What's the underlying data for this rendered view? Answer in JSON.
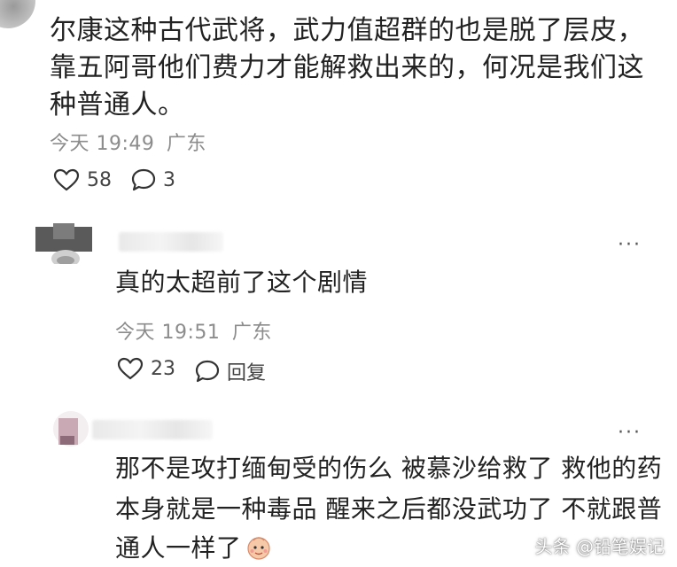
{
  "top_comment": {
    "text": "尔康这种古代武将，武力值超群的也是脱了层皮，靠五阿哥他们费力才能解救出来的，何况是我们这种普通人。",
    "time": "今天 19:49",
    "location": "广东",
    "likes": "58",
    "replies": "3"
  },
  "reply_1": {
    "text": "真的太超前了这个剧情",
    "time": "今天 19:51",
    "location": "广东",
    "likes": "23",
    "reply_label": "回复",
    "more": "···"
  },
  "reply_2": {
    "line1": "那不是攻打缅甸受的伤么 被慕沙给救了 救他的药",
    "line2": "本身就是一种毒品 醒来之后都没武功了 不就跟普",
    "line3": "通人一样了",
    "more": "···"
  },
  "icons": {
    "like": "heart-outline-icon",
    "comment": "speech-bubble-icon",
    "more": "more-dots-icon"
  },
  "watermark": "头条 @铅笔娱记"
}
